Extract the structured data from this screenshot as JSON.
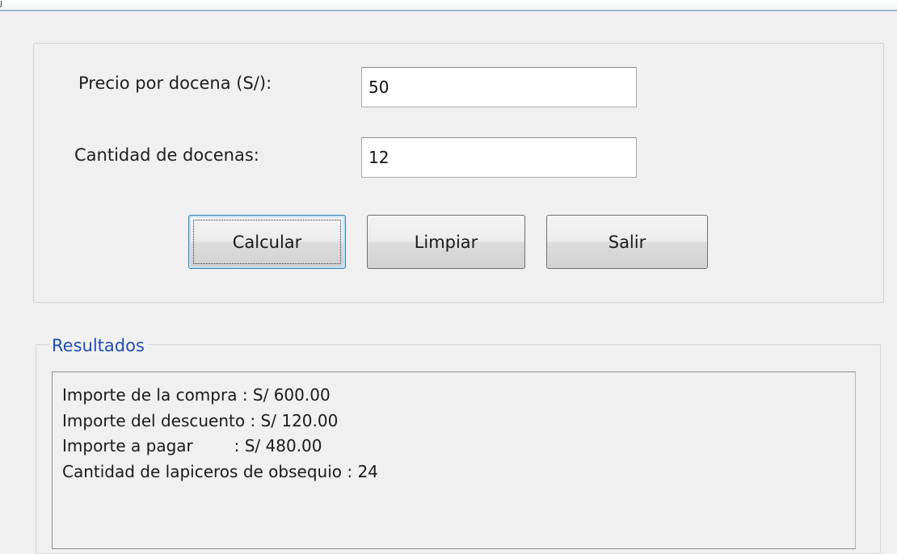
{
  "window": {
    "corner_glyph": "ȷ"
  },
  "form": {
    "price_label": "Precio por docena (S/):",
    "price_value": "50",
    "quantity_label": "Cantidad de docenas:",
    "quantity_value": "12"
  },
  "buttons": {
    "calculate": "Calcular",
    "clear": "Limpiar",
    "exit": "Salir"
  },
  "results": {
    "title": "Resultados",
    "lines": [
      "Importe de la compra : S/ 600.00",
      "Importe del descuento : S/ 120.00",
      "Importe a pagar        : S/ 480.00",
      "Cantidad de lapiceros de obsequio : 24"
    ]
  },
  "colors": {
    "group_title": "#1f4fb3",
    "default_button_border": "#3c7fb1",
    "window_background": "#f0f0f0"
  }
}
